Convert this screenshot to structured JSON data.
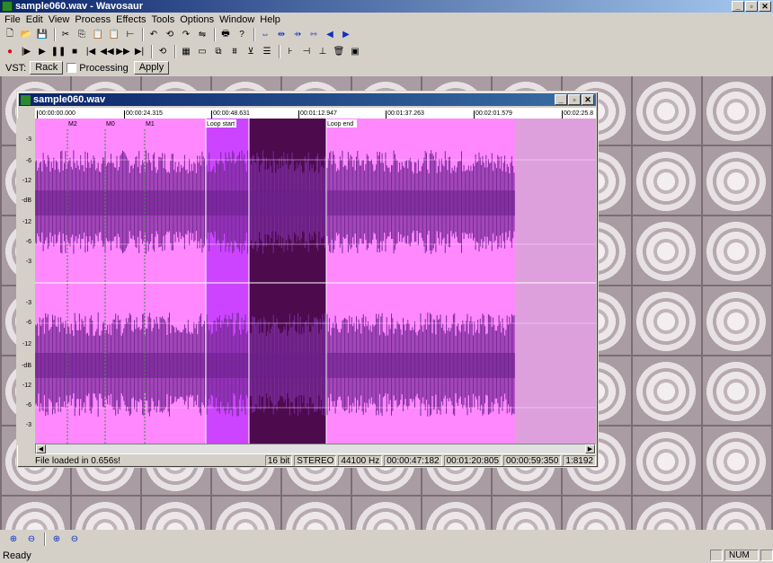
{
  "app": {
    "title": "sample060.wav - Wavosaur"
  },
  "caption_buttons": {
    "min": "_",
    "max": "▫",
    "close": "✕"
  },
  "menu": [
    "File",
    "Edit",
    "View",
    "Process",
    "Effects",
    "Tools",
    "Options",
    "Window",
    "Help"
  ],
  "toolbar1_icons": [
    "new-icon",
    "open-icon",
    "save-icon",
    "cut-icon",
    "copy-icon",
    "paste-icon",
    "paste-special-icon",
    "trim-icon",
    "undo-icon",
    "loop-icon",
    "redo-icon",
    "normalize-icon",
    "print-icon",
    "help-icon",
    "zoom-fit-icon",
    "zoom-in-h-icon",
    "zoom-out-h-icon",
    "zoom-sel-icon",
    "scroll-left-icon",
    "scroll-right-icon"
  ],
  "toolbar2_icons": [
    "record-icon",
    "play-loop-icon",
    "play-icon",
    "pause-icon",
    "stop-icon",
    "rewind-icon",
    "back-icon",
    "forward-icon",
    "end-icon",
    "loop-toggle-icon",
    "marker-icon",
    "region-icon",
    "crop-icon",
    "mix-icon",
    "fade-icon",
    "eq-icon",
    "select-icon",
    "marker-add-icon",
    "marker-del-icon",
    "trash-icon",
    "vst-icon"
  ],
  "vst": {
    "label": "VST:",
    "rack": "Rack",
    "processing": "Processing",
    "apply": "Apply"
  },
  "doc": {
    "title": "sample060.wav",
    "ruler": [
      "00:00:00.000",
      "00:00:24.315",
      "00:00:48.631",
      "00:01:12.947",
      "00:01:37.263",
      "00:02:01.579",
      "00:02:25.8"
    ],
    "markers": [
      "M2",
      "M0",
      "M1"
    ],
    "loop_start": "Loop start",
    "loop_end": "Loop end",
    "amp_labels": [
      "-3",
      "-6",
      "-12",
      "-dB",
      "-12",
      "-6",
      "-3",
      "-3",
      "-6",
      "-12",
      "-dB",
      "-12",
      "-6",
      "-3"
    ],
    "status_msg": "File loaded in 0.656s!",
    "bits": "16 bit",
    "channels": "STEREO",
    "rate": "44100 Hz",
    "pos": "00:00:47:182",
    "sel": "00:01:20:805",
    "len": "00:00:59:350",
    "zoom": "1:8192"
  },
  "colors": {
    "wave_bg": "#ff88ff",
    "wave": "#7a2a9a",
    "loop_bg": "#4d0a4d",
    "sel_bg": "#cc44ff",
    "dim_bg": "#dda0dd"
  },
  "app_status": {
    "ready": "Ready",
    "num": "NUM"
  }
}
